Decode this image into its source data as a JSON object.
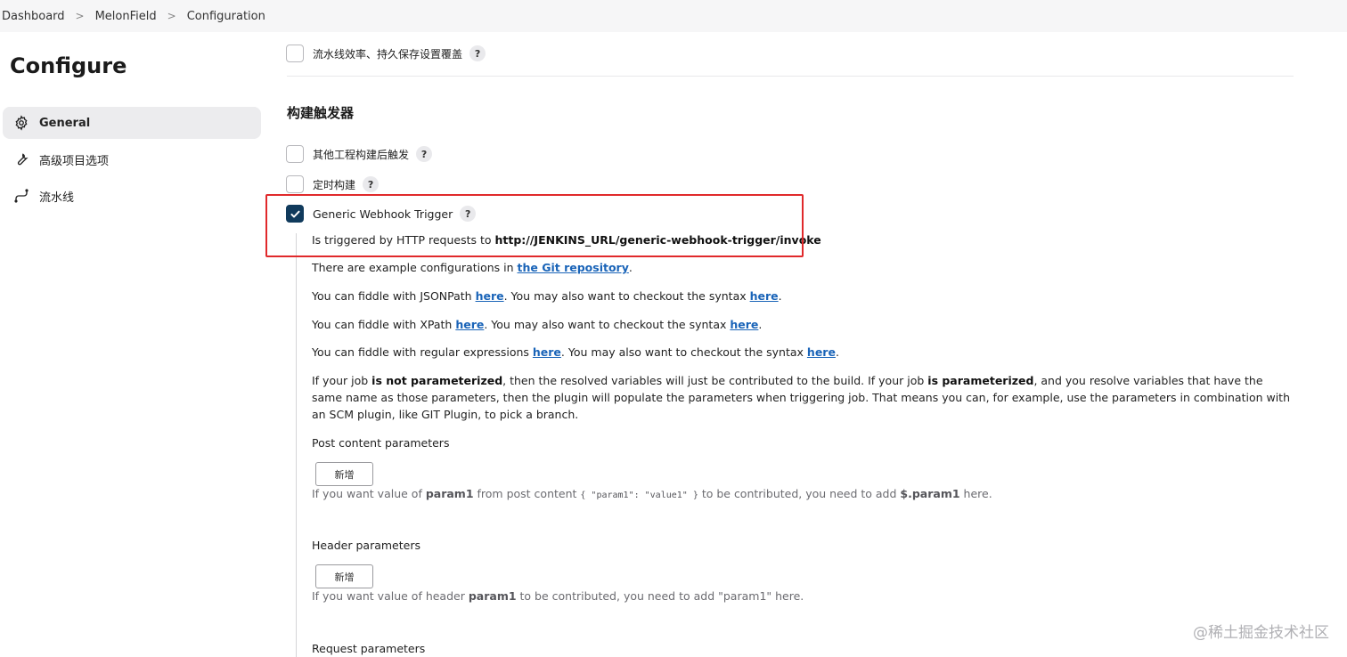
{
  "breadcrumb": {
    "items": [
      "Dashboard",
      "MelonField",
      "Configuration"
    ]
  },
  "sidebar": {
    "title": "Configure",
    "items": [
      {
        "label": "General",
        "icon": "gear-icon",
        "active": true
      },
      {
        "label": "高级项目选项",
        "icon": "wrench-icon",
        "active": false
      },
      {
        "label": "流水线",
        "icon": "pipeline-icon",
        "active": false
      }
    ]
  },
  "main": {
    "top_option": {
      "label": "流水线效率、持久保存设置覆盖",
      "checked": false
    },
    "triggers_title": "构建触发器",
    "triggers": [
      {
        "label": "其他工程构建后触发",
        "checked": false
      },
      {
        "label": "定时构建",
        "checked": false
      },
      {
        "label": "Generic Webhook Trigger",
        "checked": true
      }
    ],
    "help_mark": "?",
    "trigger_info": {
      "prefix": "Is triggered by HTTP requests to ",
      "url": "http://JENKINS_URL/generic-webhook-trigger/invoke"
    },
    "examples": {
      "prefix": "There are example configurations in ",
      "link": "the Git repository",
      "suffix": "."
    },
    "fiddle": [
      {
        "prefix": "You can fiddle with JSONPath ",
        "link1": "here",
        "middle": ". You may also want to checkout the syntax ",
        "link2": "here",
        "suffix": "."
      },
      {
        "prefix": "You can fiddle with XPath ",
        "link1": "here",
        "middle": ". You may also want to checkout the syntax ",
        "link2": "here",
        "suffix": "."
      },
      {
        "prefix": "You can fiddle with regular expressions ",
        "link1": "here",
        "middle": ". You may also want to checkout the syntax ",
        "link2": "here",
        "suffix": "."
      }
    ],
    "param_note": {
      "p1": "If your job ",
      "b1": "is not parameterized",
      "p2": ", then the resolved variables will just be contributed to the build. If your job ",
      "b2": "is parameterized",
      "p3": ", and you resolve variables that have the same name as those parameters, then the plugin will populate the parameters when triggering job. That means you can, for example, use the parameters in combination with an SCM plugin, like GIT Plugin, to pick a branch."
    },
    "post_content": {
      "label": "Post content parameters",
      "add_button": "新增",
      "hint_p1": "If you want value of ",
      "hint_b1": "param1",
      "hint_p2": " from post content ",
      "hint_code": "{ \"param1\": \"value1\" }",
      "hint_p3": " to be contributed, you need to add ",
      "hint_b2": "$.param1",
      "hint_p4": " here."
    },
    "header_params": {
      "label": "Header parameters",
      "add_button": "新增",
      "hint_p1": "If you want value of header ",
      "hint_b1": "param1",
      "hint_p2": " to be contributed, you need to add \"param1\" here."
    },
    "request_params": {
      "label": "Request parameters"
    }
  },
  "watermark": "@稀土掘金技术社区",
  "colors": {
    "accent": "#103a5c",
    "link": "#1a64b8",
    "highlight": "#e0292b"
  }
}
